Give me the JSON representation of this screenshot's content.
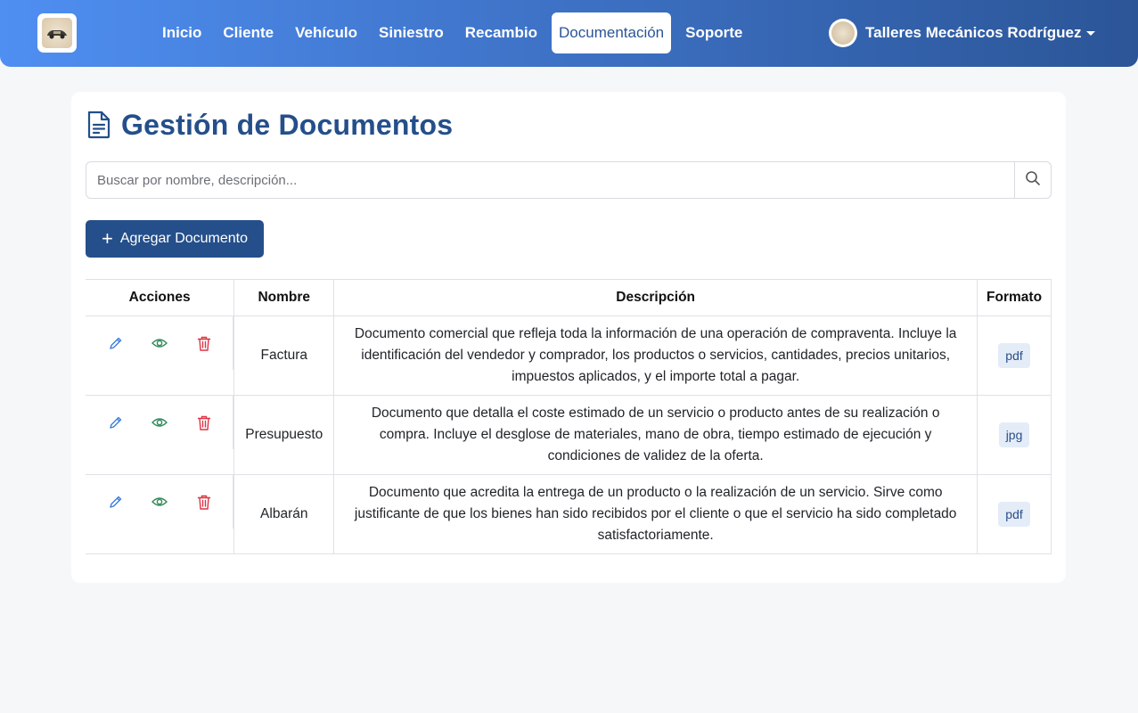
{
  "navbar": {
    "links": [
      {
        "label": "Inicio",
        "active": false
      },
      {
        "label": "Cliente",
        "active": false
      },
      {
        "label": "Vehículo",
        "active": false
      },
      {
        "label": "Siniestro",
        "active": false
      },
      {
        "label": "Recambio",
        "active": false
      },
      {
        "label": "Documentación",
        "active": true
      },
      {
        "label": "Soporte",
        "active": false
      }
    ],
    "user_name": "Talleres Mecánicos Rodríguez",
    "brand_icon": "car-logo-icon"
  },
  "page": {
    "title": "Gestión de Documentos",
    "title_icon": "document-icon",
    "search": {
      "placeholder": "Buscar por nombre, descripción...",
      "value": ""
    },
    "add_button": {
      "label": "Agregar Documento",
      "icon": "plus-icon"
    }
  },
  "table": {
    "headers": {
      "actions": "Acciones",
      "name": "Nombre",
      "description": "Descripción",
      "format": "Formato"
    },
    "rows": [
      {
        "name": "Factura",
        "description": "Documento comercial que refleja toda la información de una operación de compraventa. Incluye la identificación del vendedor y comprador, los productos o servicios, cantidades, precios unitarios, impuestos aplicados, y el importe total a pagar.",
        "format": "pdf"
      },
      {
        "name": "Presupuesto",
        "description": "Documento que detalla el coste estimado de un servicio o producto antes de su realización o compra. Incluye el desglose de materiales, mano de obra, tiempo estimado de ejecución y condiciones de validez de la oferta.",
        "format": "jpg"
      },
      {
        "name": "Albarán",
        "description": "Documento que acredita la entrega de un producto o la realización de un servicio. Sirve como justificante de que los bienes han sido recibidos por el cliente o que el servicio ha sido completado satisfactoriamente.",
        "format": "pdf"
      }
    ]
  },
  "colors": {
    "primary": "#244f8a",
    "edit": "#3b7ddd",
    "view": "#2f8a5a",
    "delete": "#dc3545",
    "badge_bg": "#e4ecf8"
  }
}
